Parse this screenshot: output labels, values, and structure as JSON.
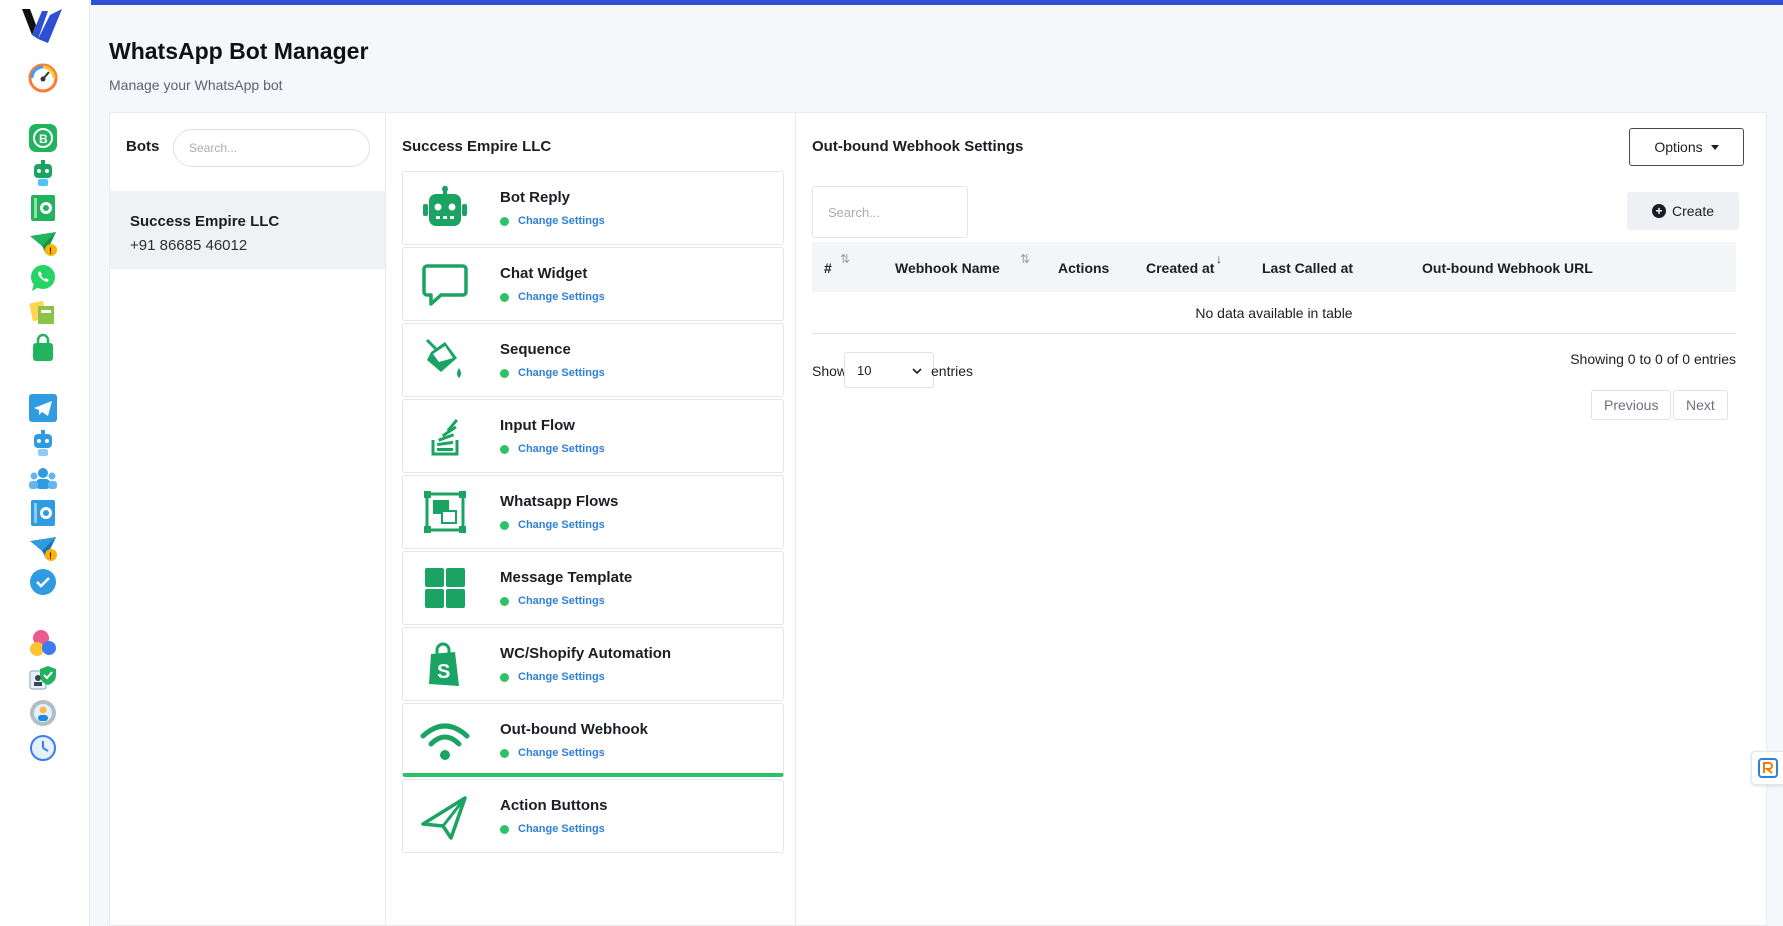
{
  "header": {
    "title": "WhatsApp Bot Manager",
    "subtitle": "Manage your WhatsApp bot"
  },
  "colors": {
    "accent": "#2d4fd1",
    "success": "#2ec268",
    "link": "#2f80d9",
    "icon_green": "#1aa363"
  },
  "rail_icons": [
    "brand-logo",
    "dashboard-gauge-icon",
    "whatsapp-business-icon",
    "whatsapp-bot-icon",
    "whatsapp-contacts-icon",
    "whatsapp-broadcast-icon",
    "whatsapp-icon",
    "catalog-icon",
    "ecommerce-bag-icon",
    "telegram-icon",
    "telegram-bot-icon",
    "telegram-group-icon",
    "telegram-contacts-icon",
    "telegram-broadcast-icon",
    "messenger-check-icon",
    "integrations-icon",
    "team-shield-icon",
    "settings-user-icon",
    "history-icon"
  ],
  "bots": {
    "label": "Bots",
    "search_placeholder": "Search...",
    "items": [
      {
        "name": "Success Empire LLC",
        "phone": "+91 86685 46012"
      }
    ]
  },
  "features": {
    "title": "Success Empire LLC",
    "items": [
      {
        "name": "Bot Reply",
        "link": "Change Settings",
        "icon": "robot-icon"
      },
      {
        "name": "Chat Widget",
        "link": "Change Settings",
        "icon": "chat-bubble-icon"
      },
      {
        "name": "Sequence",
        "link": "Change Settings",
        "icon": "paint-bucket-icon"
      },
      {
        "name": "Input Flow",
        "link": "Change Settings",
        "icon": "stack-icon"
      },
      {
        "name": "Whatsapp Flows",
        "link": "Change Settings",
        "icon": "object-group-icon"
      },
      {
        "name": "Message Template",
        "link": "Change Settings",
        "icon": "grid-icon"
      },
      {
        "name": "WC/Shopify Automation",
        "link": "Change Settings",
        "icon": "shopify-bag-icon"
      },
      {
        "name": "Out-bound Webhook",
        "link": "Change Settings",
        "icon": "wifi-icon"
      },
      {
        "name": "Action Buttons",
        "link": "Change Settings",
        "icon": "paper-plane-icon"
      }
    ],
    "active_index": 7
  },
  "webhook": {
    "title": "Out-bound Webhook Settings",
    "options_label": "Options",
    "search_placeholder": "Search...",
    "create_label": "Create",
    "columns": [
      "#",
      "Webhook Name",
      "Actions",
      "Created at",
      "Last Called at",
      "Out-bound Webhook URL"
    ],
    "empty_text": "No data available in table",
    "show_label": "Show",
    "page_size": "10",
    "entries_label": "entries",
    "showing_text": "Showing 0 to 0 of 0 entries",
    "prev_label": "Previous",
    "next_label": "Next"
  }
}
